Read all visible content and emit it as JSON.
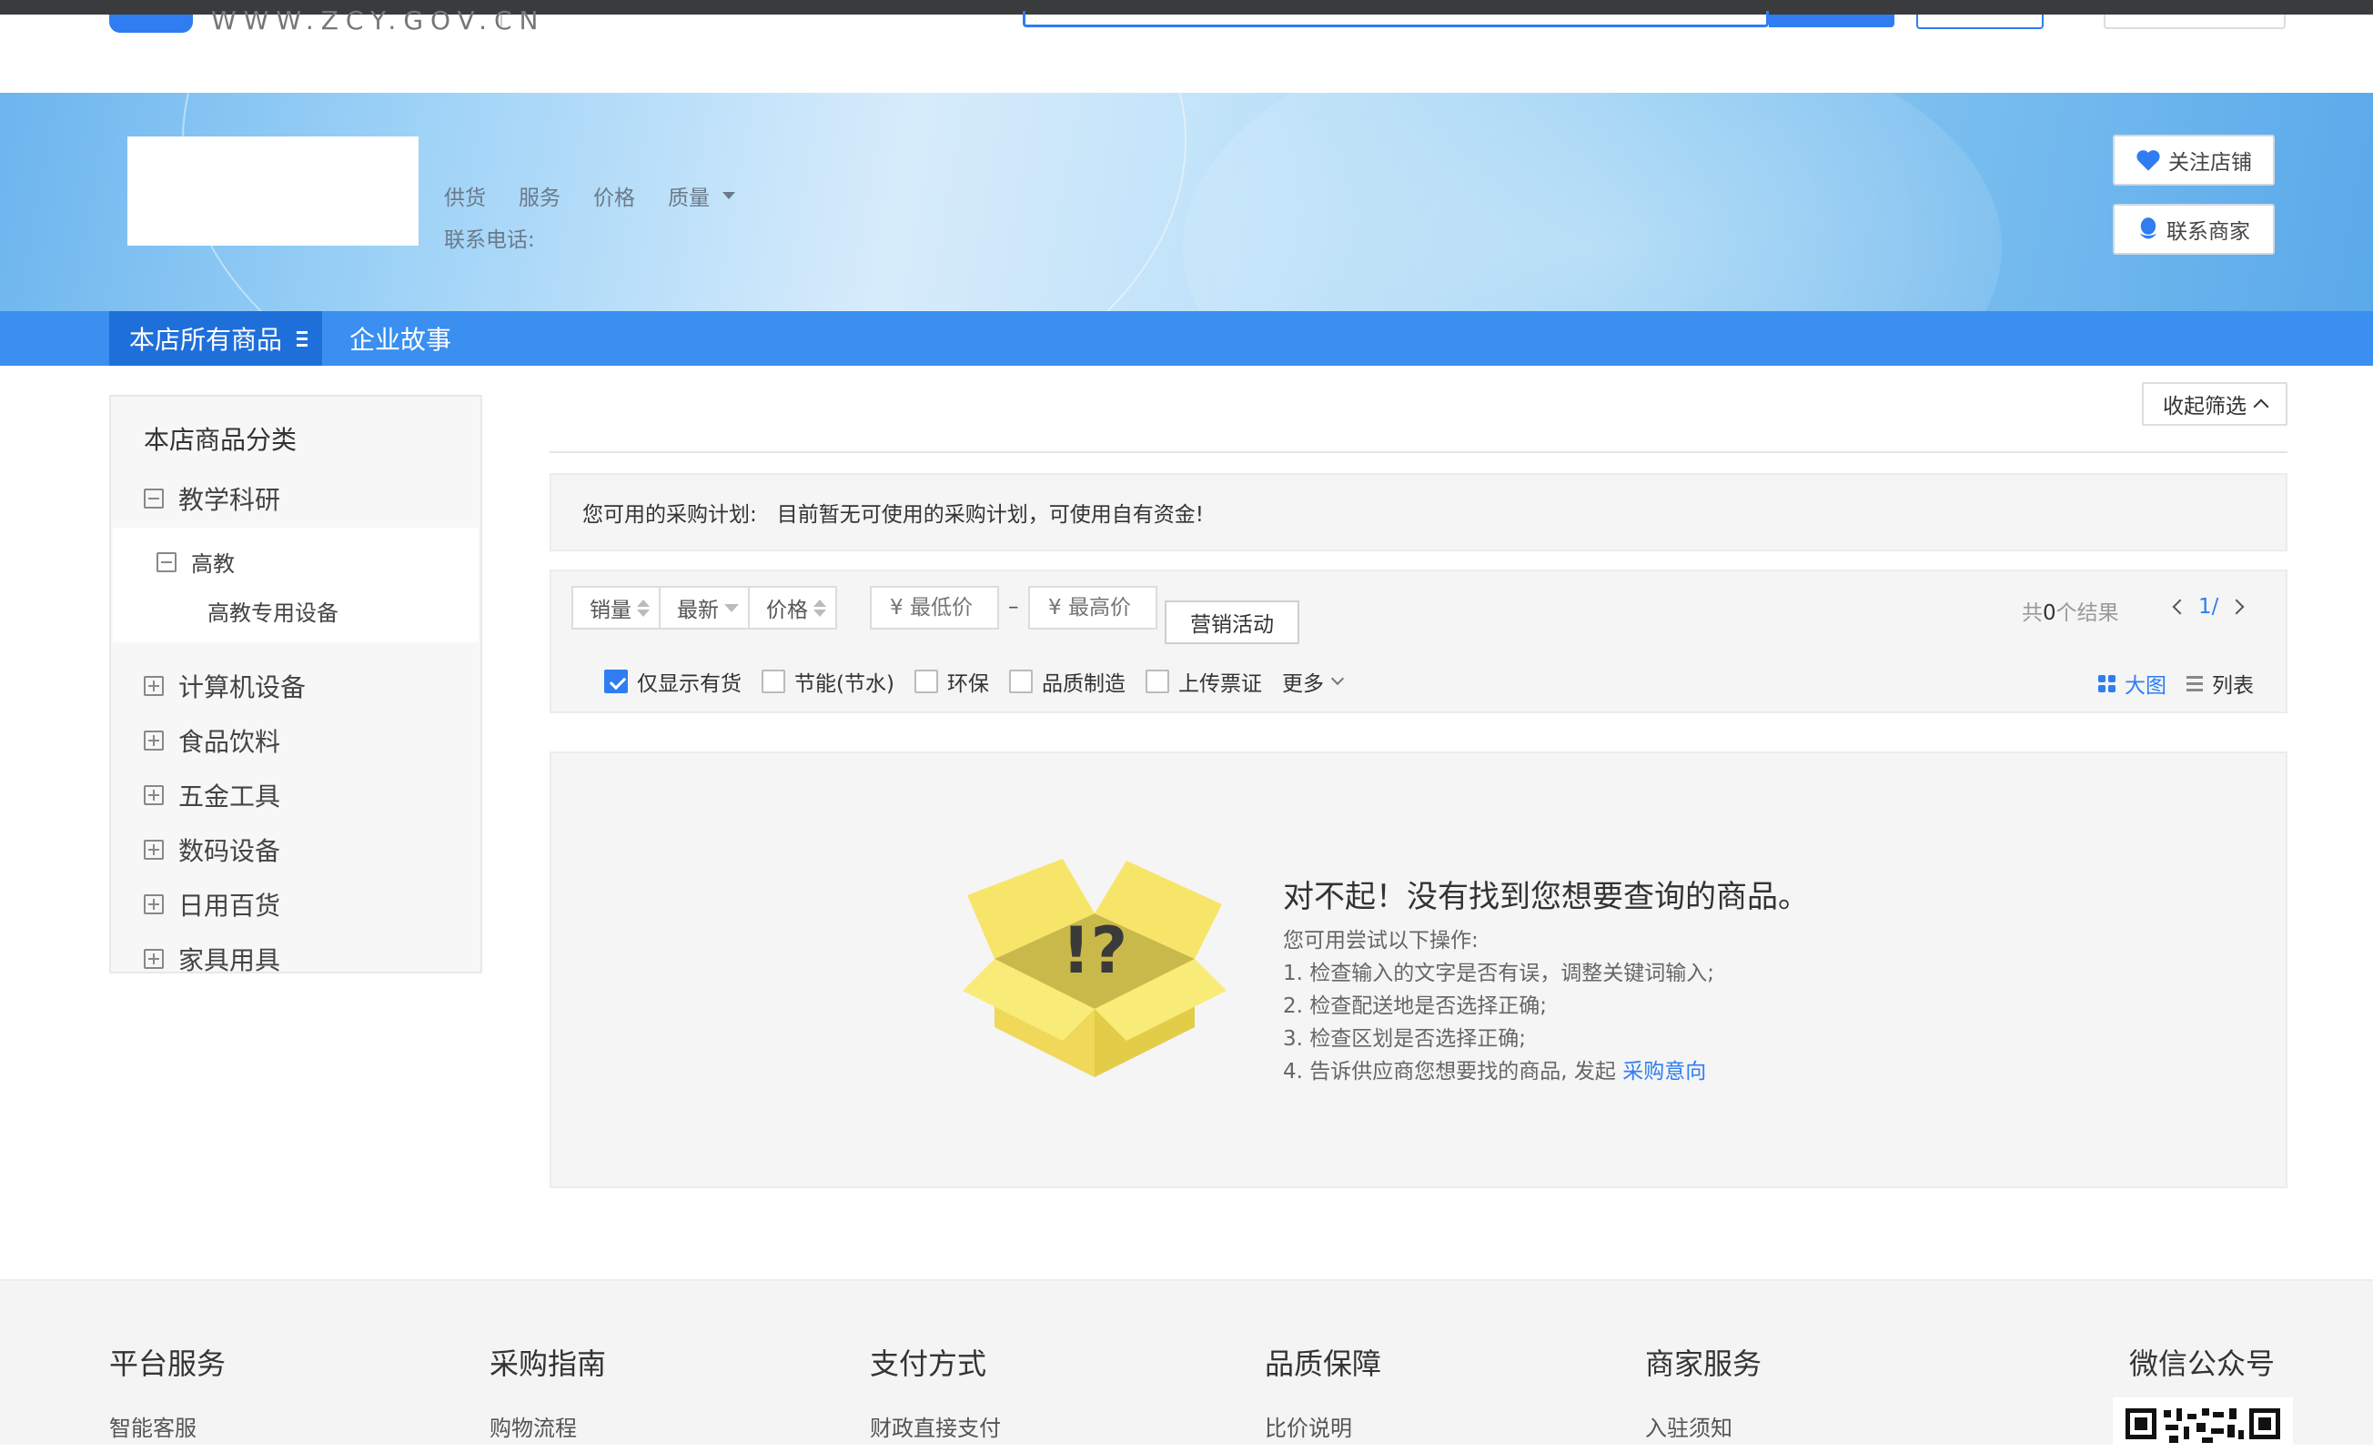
{
  "top": {
    "url": "WWW.ZCY.GOV.CN"
  },
  "store": {
    "tags": [
      "供货",
      "服务",
      "价格",
      "质量"
    ],
    "phone_label": "联系电话:",
    "follow_label": "关注店铺",
    "contact_label": "联系商家"
  },
  "nav": {
    "all_goods": "本店所有商品",
    "story": "企业故事"
  },
  "sidebar": {
    "title": "本店商品分类",
    "expanded": {
      "label": "教学科研",
      "sub": "高教",
      "leaf": "高教专用设备"
    },
    "categories": [
      "计算机设备",
      "食品饮料",
      "五金工具",
      "数码设备",
      "日用百货",
      "家具用具"
    ]
  },
  "main": {
    "collapse_label": "收起筛选",
    "plan_label": "您可用的采购计划:",
    "plan_text": "目前暂无可使用的采购计划，可使用自有资金!",
    "sort": [
      "销量",
      "最新",
      "价格"
    ],
    "price_min_placeholder": "¥ 最低价",
    "price_max_placeholder": "¥ 最高价",
    "price_dash": "–",
    "promo_label": "营销活动",
    "result_prefix": "共",
    "result_count": "0",
    "result_suffix": "个结果",
    "page": "1/",
    "filters": [
      {
        "label": "仅显示有货",
        "checked": true
      },
      {
        "label": "节能(节水)",
        "checked": false
      },
      {
        "label": "环保",
        "checked": false
      },
      {
        "label": "品质制造",
        "checked": false
      },
      {
        "label": "上传票证",
        "checked": false
      }
    ],
    "more_label": "更多",
    "view_big": "大图",
    "view_list": "列表"
  },
  "empty": {
    "title": "对不起！没有找到您想要查询的商品。",
    "intro": "您可用尝试以下操作:",
    "tip1": "1. 检查输入的文字是否有误，调整关键词输入;",
    "tip2": "2. 检查配送地是否选择正确;",
    "tip3": "3. 检查区划是否选择正确;",
    "tip4": "4. 告诉供应商您想要找的商品, 发起",
    "tip4_link": "采购意向",
    "box_mark": "!?"
  },
  "footer": {
    "cols": [
      {
        "title": "平台服务",
        "link": "智能客服"
      },
      {
        "title": "采购指南",
        "link": "购物流程"
      },
      {
        "title": "支付方式",
        "link": "财政直接支付"
      },
      {
        "title": "品质保障",
        "link": "比价说明"
      },
      {
        "title": "商家服务",
        "link": "入驻须知"
      }
    ],
    "wechat_title": "微信公众号"
  },
  "colors": {
    "accent": "#2f7df1",
    "nav": "#3a8ff0",
    "nav_active": "#1f6fdb",
    "box_yellow": "#f7e56a"
  }
}
